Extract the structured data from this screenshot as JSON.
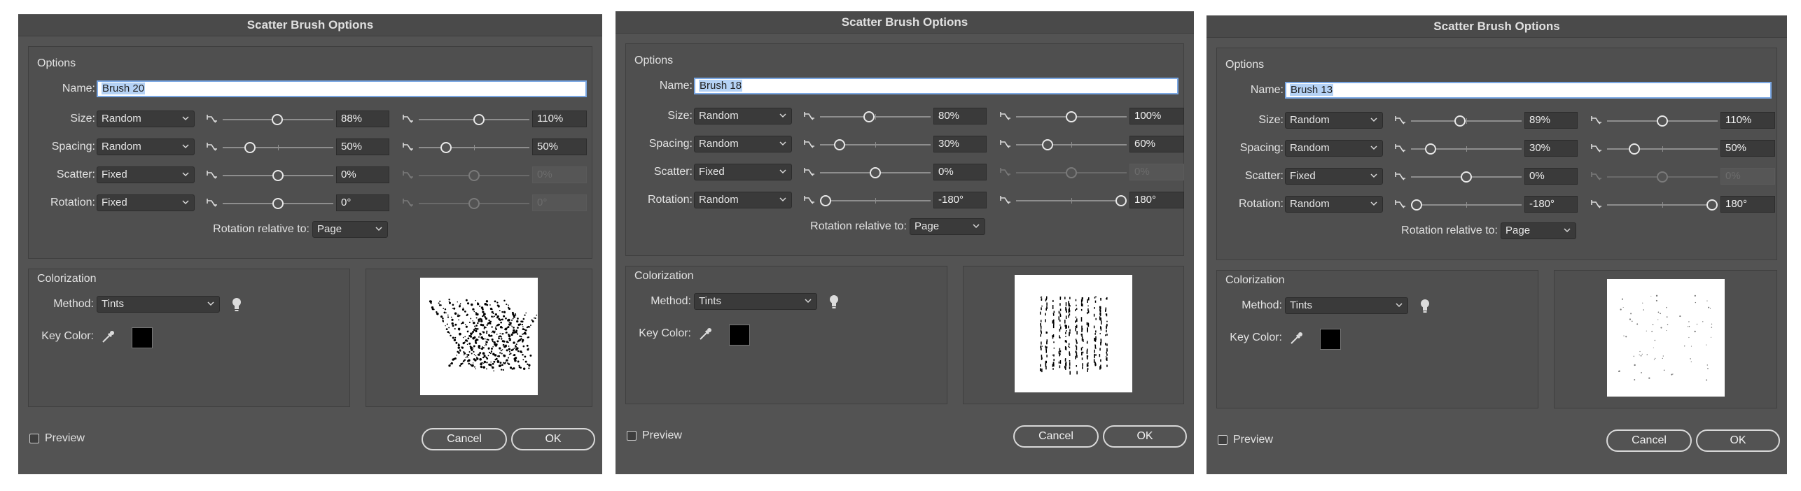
{
  "dialogs": [
    {
      "title": "Scatter Brush Options",
      "options_label": "Options",
      "name_label": "Name:",
      "name_value": "Brush 20",
      "rows": [
        {
          "label": "Size:",
          "method": "Random",
          "min": "88%",
          "max": "110%",
          "min_level": 0.49,
          "max_level": 0.55,
          "max_enabled": true
        },
        {
          "label": "Spacing:",
          "method": "Random",
          "min": "50%",
          "max": "50%",
          "min_level": 0.22,
          "max_level": 0.22,
          "max_enabled": true
        },
        {
          "label": "Scatter:",
          "method": "Fixed",
          "min": "0%",
          "max": "0%",
          "min_level": 0.5,
          "max_level": 0.5,
          "max_enabled": false
        },
        {
          "label": "Rotation:",
          "method": "Fixed",
          "min": "0°",
          "max": "0°",
          "min_level": 0.5,
          "max_level": 0.5,
          "max_enabled": false
        }
      ],
      "rotation_relative_label": "Rotation relative to:",
      "rotation_relative_value": "Page",
      "colorization_label": "Colorization",
      "method_label": "Method:",
      "method_value": "Tints",
      "key_color_label": "Key Color:",
      "key_color": "#000000",
      "preview_label": "Preview",
      "cancel_label": "Cancel",
      "ok_label": "OK"
    },
    {
      "title": "Scatter Brush Options",
      "options_label": "Options",
      "name_label": "Name:",
      "name_value": "Brush 18",
      "rows": [
        {
          "label": "Size:",
          "method": "Random",
          "min": "80%",
          "max": "100%",
          "min_level": 0.44,
          "max_level": 0.5,
          "max_enabled": true
        },
        {
          "label": "Spacing:",
          "method": "Random",
          "min": "30%",
          "max": "60%",
          "min_level": 0.14,
          "max_level": 0.26,
          "max_enabled": true
        },
        {
          "label": "Scatter:",
          "method": "Fixed",
          "min": "0%",
          "max": "0%",
          "min_level": 0.5,
          "max_level": 0.5,
          "max_enabled": false
        },
        {
          "label": "Rotation:",
          "method": "Random",
          "min": "-180°",
          "max": "180°",
          "min_level": 0.0,
          "max_level": 1.0,
          "max_enabled": true
        }
      ],
      "rotation_relative_label": "Rotation relative to:",
      "rotation_relative_value": "Page",
      "colorization_label": "Colorization",
      "method_label": "Method:",
      "method_value": "Tints",
      "key_color_label": "Key Color:",
      "key_color": "#000000",
      "preview_label": "Preview",
      "cancel_label": "Cancel",
      "ok_label": "OK"
    },
    {
      "title": "Scatter Brush Options",
      "options_label": "Options",
      "name_label": "Name:",
      "name_value": "Brush 13",
      "rows": [
        {
          "label": "Size:",
          "method": "Random",
          "min": "89%",
          "max": "110%",
          "min_level": 0.44,
          "max_level": 0.5,
          "max_enabled": true
        },
        {
          "label": "Spacing:",
          "method": "Random",
          "min": "30%",
          "max": "50%",
          "min_level": 0.14,
          "max_level": 0.22,
          "max_enabled": true
        },
        {
          "label": "Scatter:",
          "method": "Fixed",
          "min": "0%",
          "max": "0%",
          "min_level": 0.5,
          "max_level": 0.5,
          "max_enabled": false
        },
        {
          "label": "Rotation:",
          "method": "Random",
          "min": "-180°",
          "max": "180°",
          "min_level": 0.0,
          "max_level": 1.0,
          "max_enabled": true
        }
      ],
      "rotation_relative_label": "Rotation relative to:",
      "rotation_relative_value": "Page",
      "colorization_label": "Colorization",
      "method_label": "Method:",
      "method_value": "Tints",
      "key_color_label": "Key Color:",
      "key_color": "#000000",
      "preview_label": "Preview",
      "cancel_label": "Cancel",
      "ok_label": "OK"
    }
  ],
  "icons": {
    "pin": "pressure-pin-icon",
    "tip": "lightbulb-icon",
    "eyedropper": "eyedropper-icon",
    "chevron": "chevron-down-icon"
  }
}
